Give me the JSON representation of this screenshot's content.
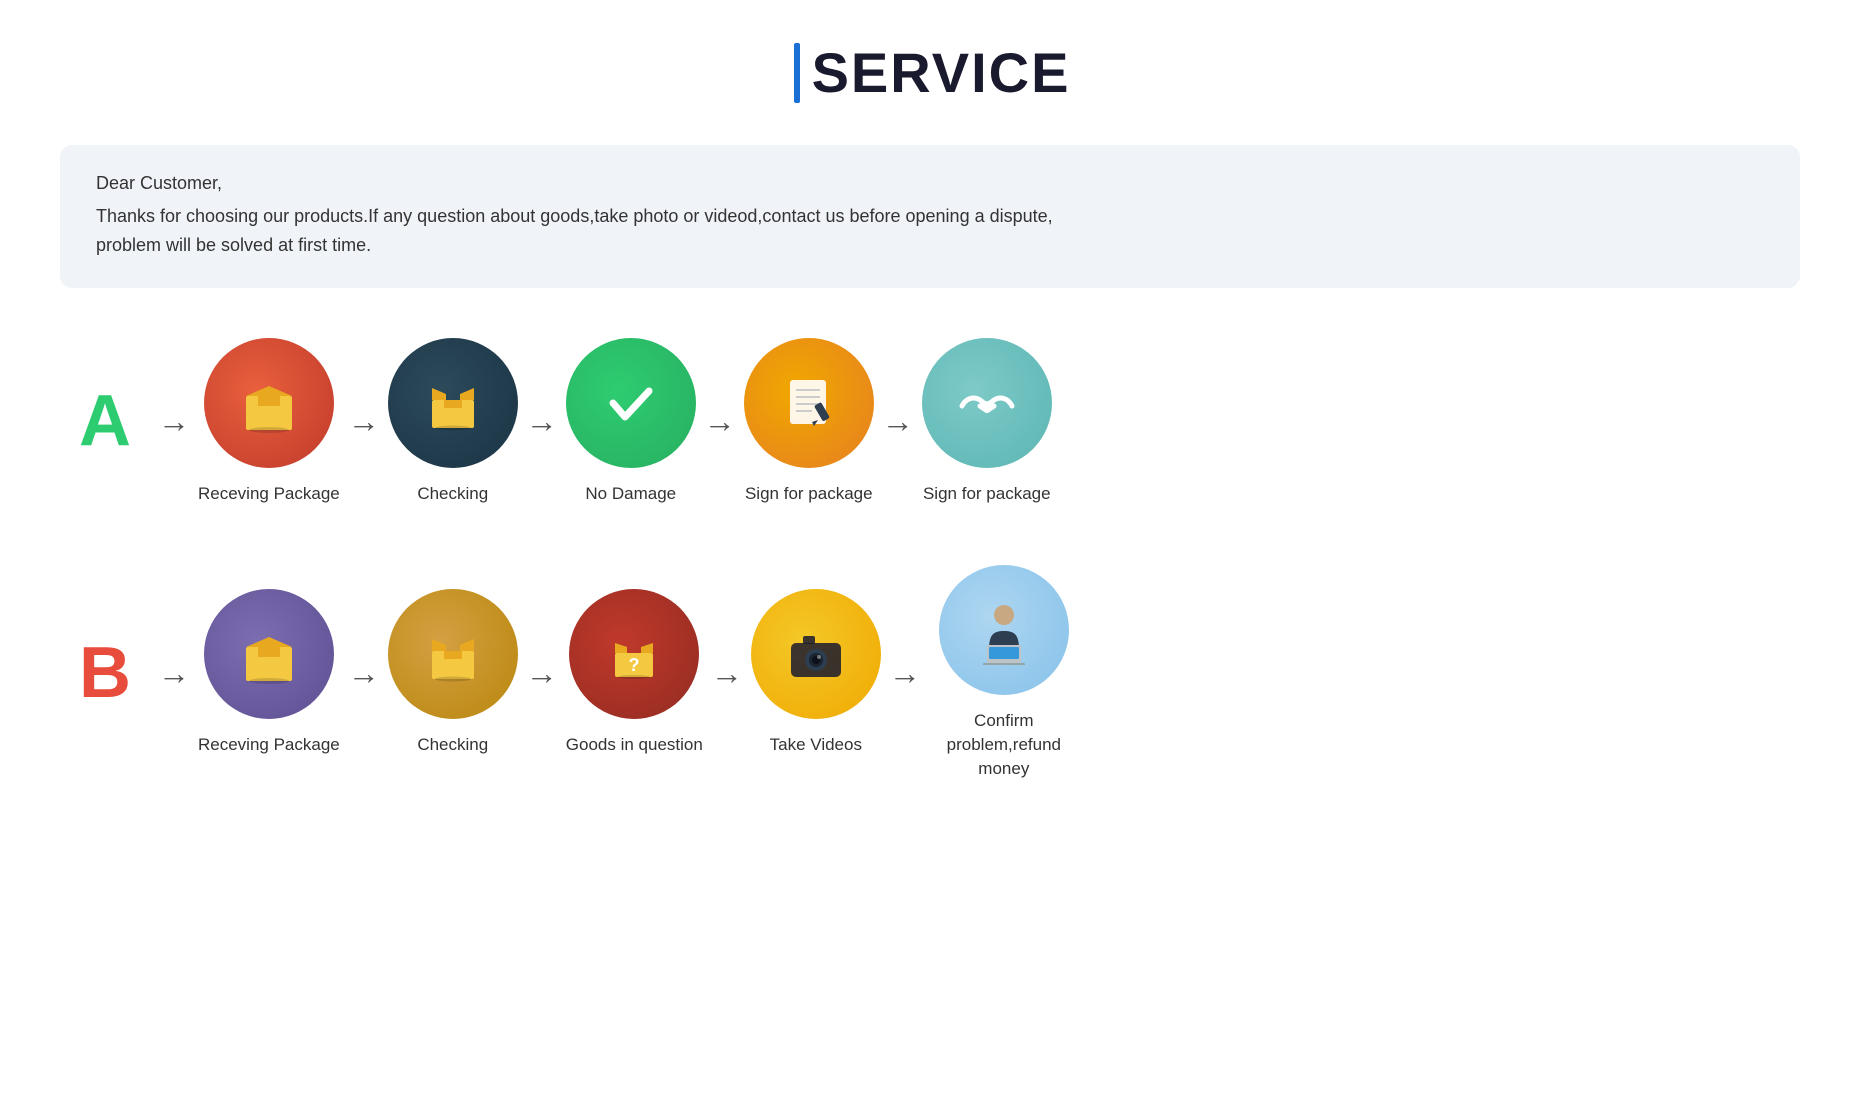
{
  "title": {
    "bar_color": "#1a6fd4",
    "text": "SERVICE"
  },
  "notice": {
    "greeting": "Dear Customer,",
    "body": "Thanks for choosing our products.If any question about goods,take photo or videod,contact us before opening a dispute,\nproblem will be solved at first time."
  },
  "row_a": {
    "letter": "A",
    "steps": [
      {
        "label": "Receving Package",
        "icon": "red-box"
      },
      {
        "label": "Checking",
        "icon": "dark-box"
      },
      {
        "label": "No Damage",
        "icon": "green-check"
      },
      {
        "label": "Sign for package",
        "icon": "orange-sign"
      },
      {
        "label": "Sign for package",
        "icon": "teal-handshake"
      }
    ]
  },
  "row_b": {
    "letter": "B",
    "steps": [
      {
        "label": "Receving Package",
        "icon": "purple-box"
      },
      {
        "label": "Checking",
        "icon": "brown-box"
      },
      {
        "label": "Goods in question",
        "icon": "red-question"
      },
      {
        "label": "Take Videos",
        "icon": "yellow-camera"
      },
      {
        "label": "Confirm  problem,refund money",
        "icon": "blue-person"
      }
    ]
  }
}
